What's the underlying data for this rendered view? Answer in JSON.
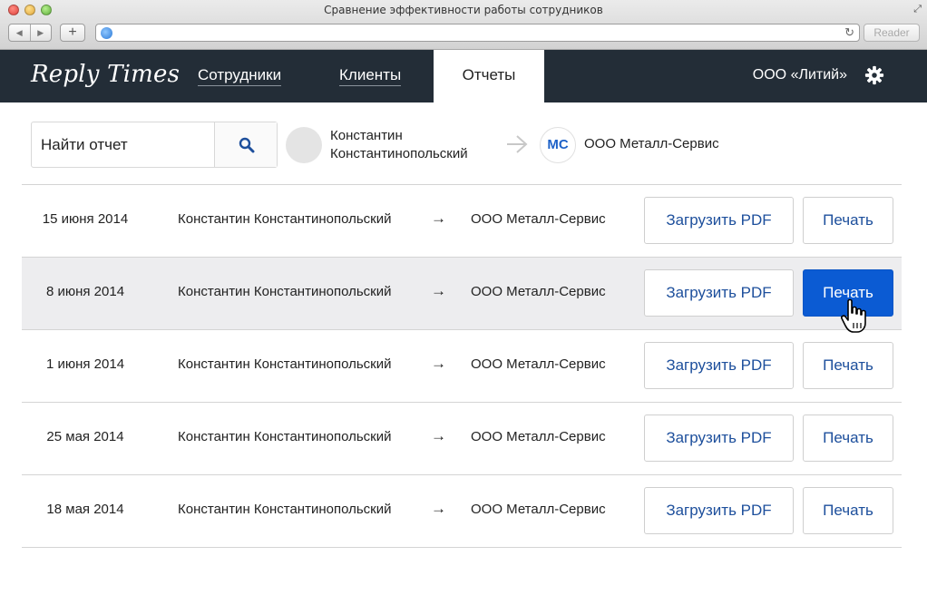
{
  "window": {
    "title": "Сравнение эффективности работы сотрудников",
    "reader_label": "Reader"
  },
  "app": {
    "logo": "Reply Times",
    "nav": {
      "staff": "Сотрудники",
      "clients": "Клиенты",
      "reports": "Отчеты"
    },
    "company": "ООО «Литий»"
  },
  "filter": {
    "search_placeholder": "Найти отчет",
    "person_name": "Константин Константинопольский",
    "company_initials": "МС",
    "company_name": "ООО Металл-Сервис"
  },
  "reports": [
    {
      "date": "15 июня 2014",
      "person": "Константин Константинопольский",
      "arrow": "→",
      "company": "ООО Металл-Сервис",
      "pdf_label": "Загрузить PDF",
      "print_label": "Печать"
    },
    {
      "date": "8 июня 2014",
      "person": "Константин Константинопольский",
      "arrow": "→",
      "company": "ООО Металл-Сервис",
      "pdf_label": "Загрузить PDF",
      "print_label": "Печать"
    },
    {
      "date": "1 июня 2014",
      "person": "Константин Константинопольский",
      "arrow": "→",
      "company": "ООО Металл-Сервис",
      "pdf_label": "Загрузить PDF",
      "print_label": "Печать"
    },
    {
      "date": "25 мая 2014",
      "person": "Константин Константинопольский",
      "arrow": "→",
      "company": "ООО Металл-Сервис",
      "pdf_label": "Загрузить PDF",
      "print_label": "Печать"
    },
    {
      "date": "18 мая 2014",
      "person": "Константин Константинопольский",
      "arrow": "→",
      "company": "ООО Металл-Сервис",
      "pdf_label": "Загрузить PDF",
      "print_label": "Печать"
    }
  ],
  "colors": {
    "nav_bg": "#232d37",
    "accent": "#0b5bd3",
    "link": "#1d4f9c",
    "row_highlight": "#ededef"
  }
}
